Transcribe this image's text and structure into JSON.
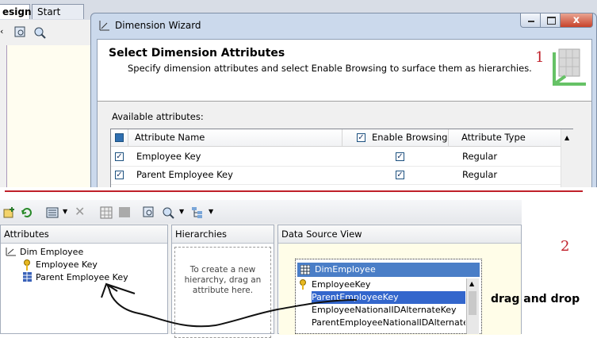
{
  "tabs": [
    {
      "label": "esign]*"
    },
    {
      "label": "Start Page"
    }
  ],
  "wizard": {
    "title": "Dimension Wizard",
    "heading": "Select Dimension Attributes",
    "subheading": "Specify dimension attributes and select Enable Browsing to surface them as hierarchies.",
    "available_label": "Available attributes:",
    "columns": [
      "Attribute Name",
      "Enable Browsing",
      "Attribute Type"
    ],
    "rows": [
      {
        "name": "Employee Key",
        "browsing": true,
        "type": "Regular",
        "checked": true
      },
      {
        "name": "Parent Employee Key",
        "browsing": true,
        "type": "Regular",
        "checked": true
      }
    ],
    "close_label": "x"
  },
  "annotations": {
    "step1": "1",
    "step2": "2",
    "drag_drop": "drag and drop"
  },
  "designer": {
    "panes": {
      "attributes": "Attributes",
      "hierarchies": "Hierarchies",
      "dsv": "Data Source View"
    },
    "tree": {
      "root": "Dim Employee",
      "items": [
        "Employee Key",
        "Parent Employee Key"
      ]
    },
    "hier_hint": "To create a new hierarchy, drag an attribute here.",
    "table": {
      "name": "DimEmployee",
      "columns": [
        "EmployeeKey",
        "ParentEmployeeKey",
        "EmployeeNationalIDAlternateKey",
        "ParentEmployeeNationalIDAlternate..."
      ]
    }
  },
  "colors": {
    "accent": "#c0202a",
    "table_header": "#4a7ec7",
    "selected_row": "#3366cc"
  }
}
